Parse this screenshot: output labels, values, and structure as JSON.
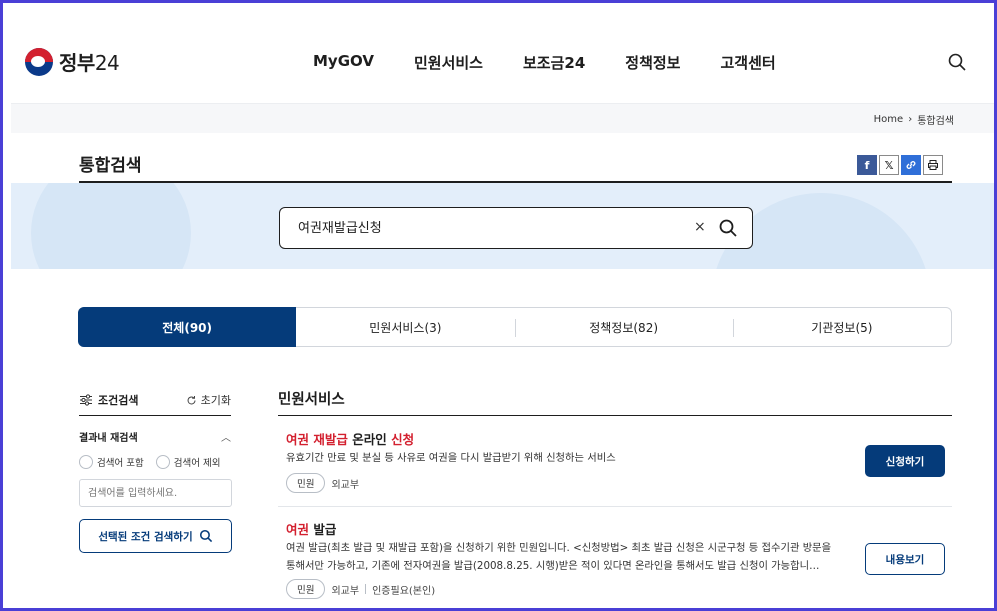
{
  "header": {
    "logo_text": "정부",
    "logo_num": "24",
    "nav": [
      "MyGOV",
      "민원서비스",
      "보조금24",
      "정책정보",
      "고객센터"
    ]
  },
  "breadcrumb": {
    "home": "Home",
    "sep": "›",
    "current": "통합검색"
  },
  "page": {
    "title": "통합검색"
  },
  "share": {
    "fb": "f",
    "x": "𝕏",
    "link": "🔗",
    "print": "⎙"
  },
  "search": {
    "value": "여권재발급신청",
    "clear": "×"
  },
  "tabs": [
    {
      "label": "전체(90)"
    },
    {
      "label": "민원서비스(3)"
    },
    {
      "label": "정책정보(82)"
    },
    {
      "label": "기관정보(5)"
    }
  ],
  "filter": {
    "title": "조건검색",
    "reset": "초기화",
    "sub_title": "결과내 재검색",
    "chevron": "︿",
    "radio_include": "검색어 포함",
    "radio_exclude": "검색어 제외",
    "input_placeholder": "검색어를 입력하세요.",
    "apply": "선택된 조건 검색하기"
  },
  "results_section": {
    "title": "민원서비스"
  },
  "results": [
    {
      "title_parts": [
        "여권 재발급",
        " 온라인 ",
        "신청"
      ],
      "desc": "유효기간 만료 및 분실 등 사유로 여권을 다시 발급받기 위해 신청하는 서비스",
      "badge": "민원",
      "agency": "외교부",
      "button": "신청하기"
    },
    {
      "title_parts": [
        "여권",
        " 발급"
      ],
      "desc_line1": "여권 발급(최초 발급 및 재발급 포함)을 신청하기 위한 민원입니다. <신청방법> 최초 발급 신청은 시군구청 등 접수기관 방문을",
      "desc_line2": "통해서만 가능하고, 기존에 전자여권을 발급(2008.8.25. 시행)받은 적이 있다면 온라인을 통해서도 발급 신청이 가능합니…",
      "badge": "민원",
      "agency": "외교부",
      "extra": "인증필요(본인)",
      "button": "내용보기"
    }
  ],
  "colors": {
    "primary": "#053b7a",
    "highlight": "#d3202f",
    "band": "#e3eefa"
  }
}
